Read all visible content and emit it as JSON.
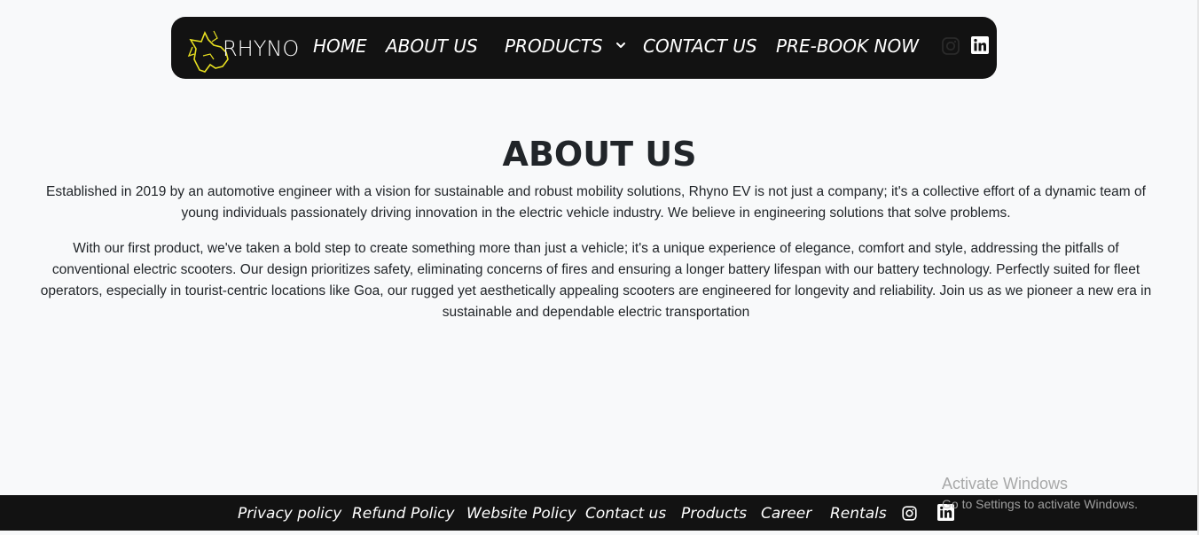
{
  "nav": {
    "logo_text": "RHYNO",
    "items": [
      {
        "label": "HOME"
      },
      {
        "label": "ABOUT US"
      },
      {
        "label": "PRODUCTS"
      },
      {
        "label": "CONTACT US"
      },
      {
        "label": "PRE-BOOK NOW"
      }
    ],
    "icons": [
      "instagram-icon",
      "linkedin-icon",
      "chevron-down-icon"
    ]
  },
  "main": {
    "title": "ABOUT US",
    "paragraphs": [
      "Established in 2019 by an automotive engineer with a vision for sustainable and robust mobility solutions, Rhyno EV is not just a company; it's a collective effort of a dynamic team of young individuals passionately driving innovation in the electric vehicle industry. We believe in engineering solutions that solve problems.",
      "With our first product, we've taken a bold step to create something more than just a vehicle; it's a unique experience of elegance, comfort and style, addressing the pitfalls of conventional electric scooters. Our design prioritizes safety, eliminating concerns of fires and ensuring a longer battery lifespan with our battery technology. Perfectly suited for fleet operators, especially in tourist-centric locations like Goa, our rugged yet aesthetically appealing scooters are engineered for longevity and reliability. Join us as we pioneer a new era in sustainable and dependable electric transportation"
    ]
  },
  "footer": {
    "links": [
      {
        "label": "Privacy policy"
      },
      {
        "label": "Refund Policy"
      },
      {
        "label": "Website Policy"
      },
      {
        "label": "Contact us"
      },
      {
        "label": "Products"
      },
      {
        "label": "Career"
      },
      {
        "label": "Rentals"
      }
    ]
  },
  "watermark": {
    "title": "Activate Windows",
    "subtitle": "Go to Settings to activate Windows."
  },
  "colors": {
    "nav_bg": "#121212",
    "page_bg": "#f8f9fa",
    "logo_accent": "#e8e020",
    "text": "#212529"
  }
}
